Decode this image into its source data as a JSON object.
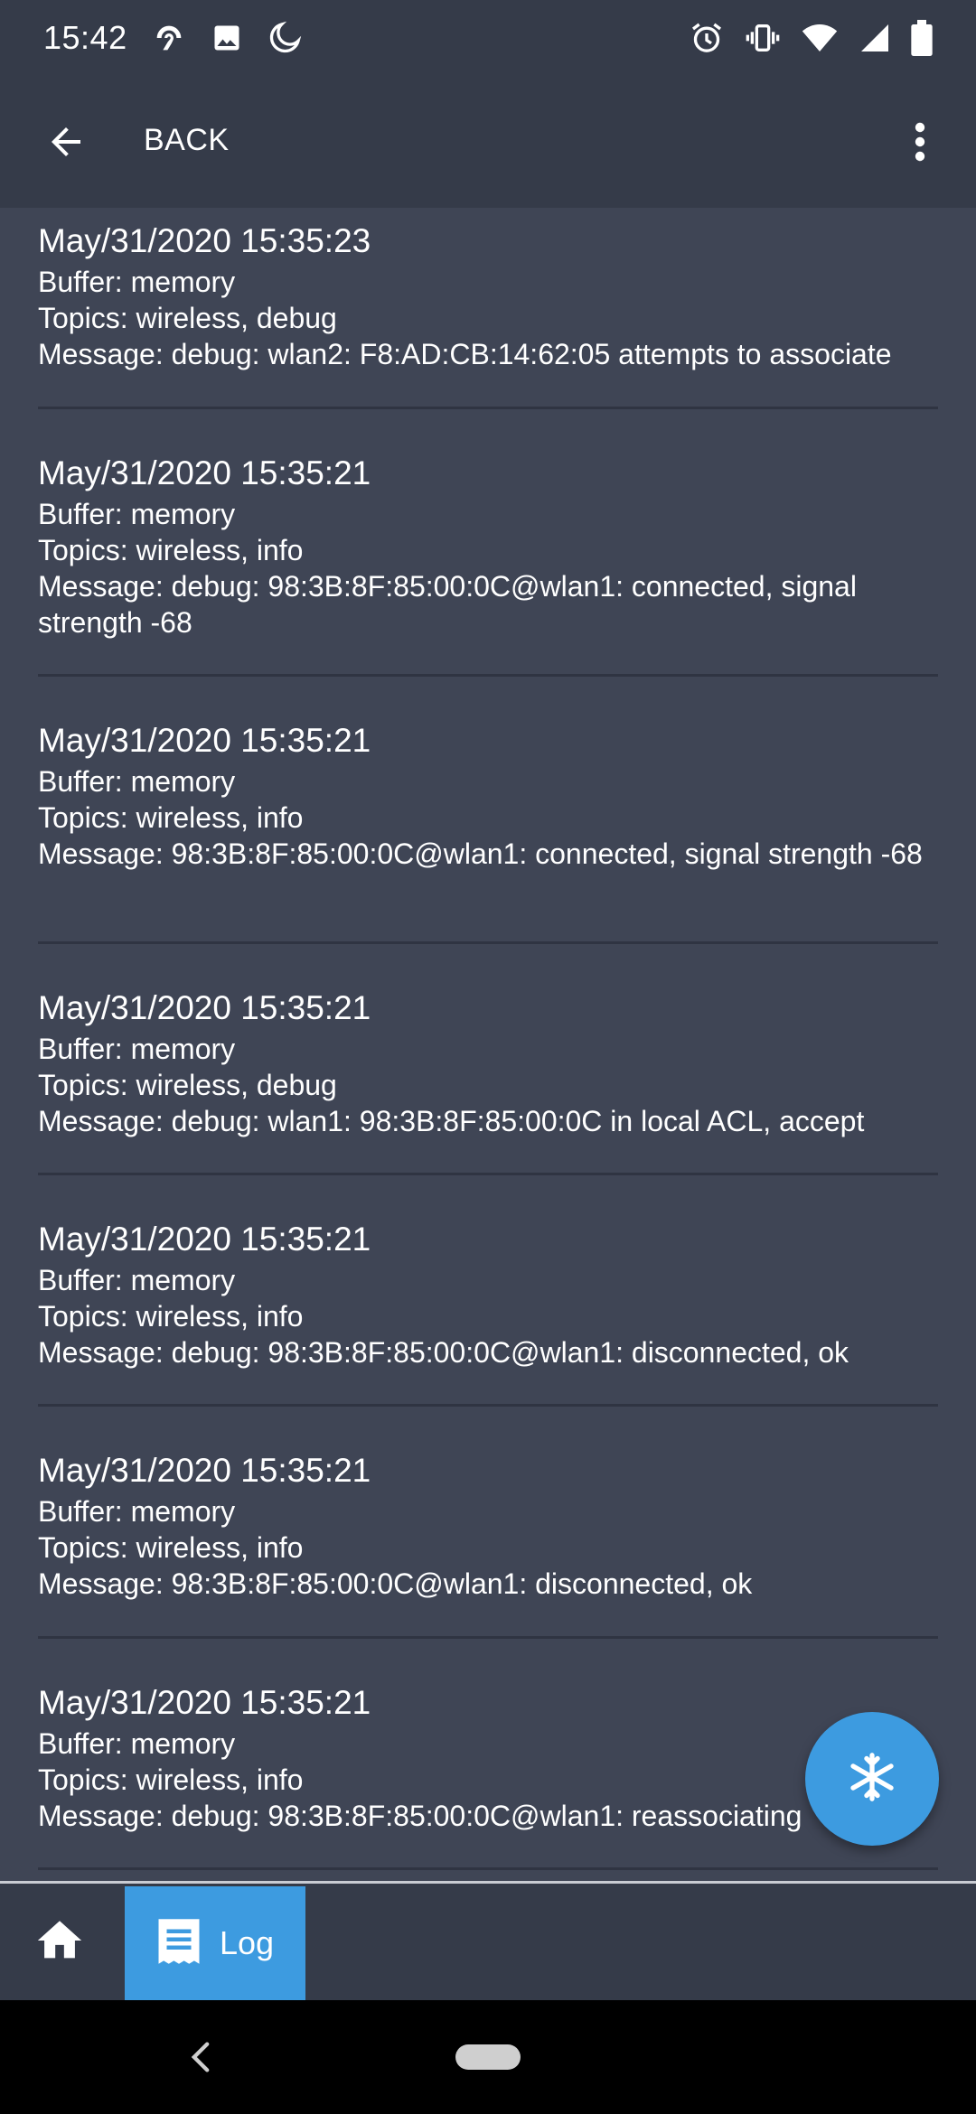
{
  "status_bar": {
    "time": "15:42",
    "left_icons": [
      "hotspot-icon",
      "image-icon",
      "moon-icon"
    ],
    "right_icons": [
      "alarm-icon",
      "vibrate-icon",
      "wifi-icon",
      "signal-icon",
      "battery-icon"
    ]
  },
  "app_bar": {
    "back_label": "BACK"
  },
  "log": {
    "entries": [
      {
        "timestamp": "May/31/2020 15:35:23",
        "buffer": "Buffer: memory",
        "topics": "Topics: wireless, debug",
        "message": "Message: debug: wlan2: F8:AD:CB:14:62:05 attempts to associate"
      },
      {
        "timestamp": "May/31/2020 15:35:21",
        "buffer": "Buffer: memory",
        "topics": "Topics: wireless, info",
        "message": "Message: debug: 98:3B:8F:85:00:0C@wlan1: connected, signal strength -68"
      },
      {
        "timestamp": "May/31/2020 15:35:21",
        "buffer": "Buffer: memory",
        "topics": "Topics: wireless, info",
        "message": "Message: 98:3B:8F:85:00:0C@wlan1: connected, signal strength -68"
      },
      {
        "timestamp": "May/31/2020 15:35:21",
        "buffer": "Buffer: memory",
        "topics": "Topics: wireless, debug",
        "message": "Message: debug: wlan1: 98:3B:8F:85:00:0C in local ACL, accept"
      },
      {
        "timestamp": "May/31/2020 15:35:21",
        "buffer": "Buffer: memory",
        "topics": "Topics: wireless, info",
        "message": "Message: debug: 98:3B:8F:85:00:0C@wlan1: disconnected, ok"
      },
      {
        "timestamp": "May/31/2020 15:35:21",
        "buffer": "Buffer: memory",
        "topics": "Topics: wireless, info",
        "message": "Message: 98:3B:8F:85:00:0C@wlan1: disconnected, ok"
      },
      {
        "timestamp": "May/31/2020 15:35:21",
        "buffer": "Buffer: memory",
        "topics": "Topics: wireless, info",
        "message": "Message: debug: 98:3B:8F:85:00:0C@wlan1: reassociating"
      }
    ]
  },
  "fab": {
    "icon": "snowflake-icon"
  },
  "tabs": {
    "home_icon": "home-icon",
    "log_label": "Log",
    "log_icon": "log-icon"
  },
  "colors": {
    "background": "#3f4555",
    "bar": "#353b49",
    "accent": "#3d9be0",
    "divider": "#2f3442"
  }
}
